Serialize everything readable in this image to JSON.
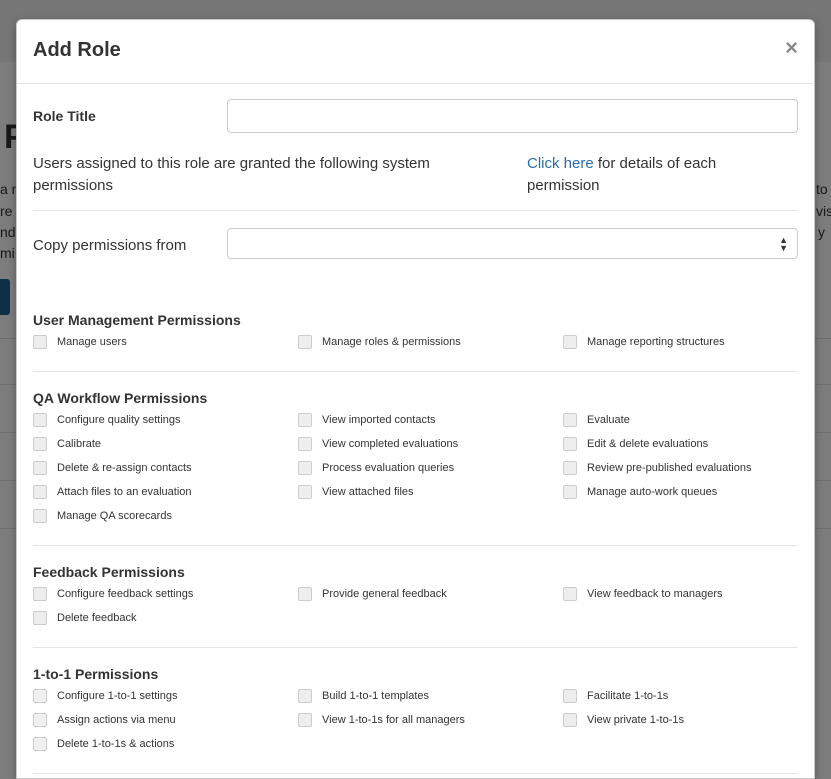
{
  "modal": {
    "title": "Add Role",
    "close_glyph": "×",
    "role_title_label": "Role Title",
    "role_title_value": "",
    "description": "Users assigned to this role are granted the following system permissions",
    "details_link": "Click here",
    "details_rest": " for details of each permission",
    "copy_label": "Copy permissions from",
    "copy_value": ""
  },
  "sections": [
    {
      "title": "User Management Permissions",
      "permissions": [
        "Manage users",
        "Manage roles & permissions",
        "Manage reporting structures"
      ]
    },
    {
      "title": "QA Workflow Permissions",
      "permissions": [
        "Configure quality settings",
        "View imported contacts",
        "Evaluate",
        "Calibrate",
        "View completed evaluations",
        "Edit & delete evaluations",
        "Delete & re-assign contacts",
        "Process evaluation queries",
        "Review pre-published evaluations",
        "Attach files to an evaluation",
        "View attached files",
        "Manage auto-work queues",
        "Manage QA scorecards"
      ]
    },
    {
      "title": "Feedback Permissions",
      "permissions": [
        "Configure feedback settings",
        "Provide general feedback",
        "View feedback to managers",
        "Delete feedback"
      ]
    },
    {
      "title": "1-to-1 Permissions",
      "permissions": [
        "Configure 1-to-1 settings",
        "Build 1-to-1 templates",
        "Facilitate 1-to-1s",
        "Assign actions via menu",
        "View 1-to-1s for all managers",
        "View private 1-to-1s",
        "Delete 1-to-1s & actions"
      ]
    }
  ],
  "background": {
    "big_letter": "P",
    "left_fragments": [
      "a n",
      "re",
      "nd",
      "mi"
    ],
    "right_fragments": [
      "to",
      "vis",
      "y"
    ]
  }
}
